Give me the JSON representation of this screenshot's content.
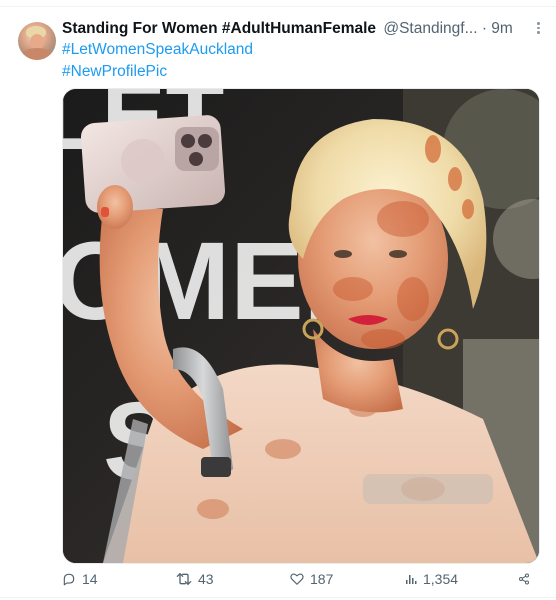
{
  "tweet": {
    "author_name": "Standing For Women #AdultHumanFemale",
    "author_handle": "@Standingf...",
    "time": "· 9m",
    "hashtags": [
      "#LetWomenSpeakAuckland",
      "#NewProfilePic"
    ],
    "media": {
      "description_icon": "photo",
      "sign_text": "LET WOMEN"
    },
    "actions": {
      "replies": "14",
      "retweets": "43",
      "likes": "187",
      "views": "1,354"
    }
  },
  "colors": {
    "link": "#1d9bf0",
    "secondary_text": "#536471",
    "primary_text": "#0f1419",
    "divider": "#eff3f4"
  }
}
